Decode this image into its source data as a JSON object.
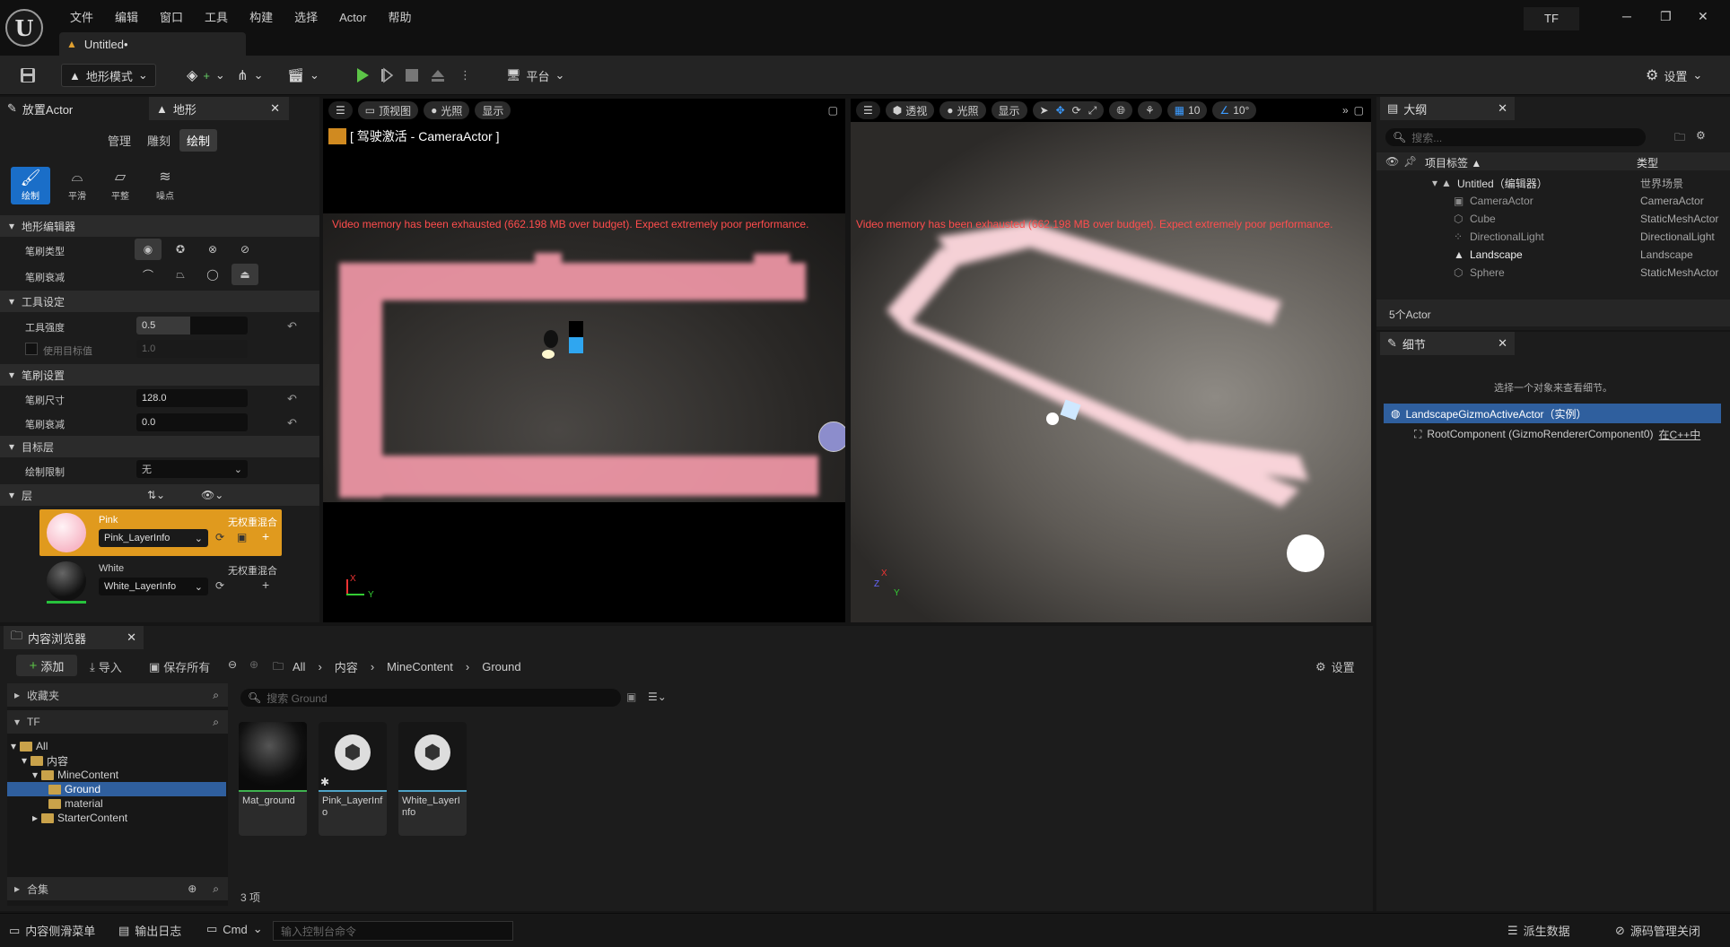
{
  "app": {
    "menu": [
      "文件",
      "编辑",
      "窗口",
      "工具",
      "构建",
      "选择",
      "Actor",
      "帮助"
    ],
    "doc_tab": "Untitled•",
    "user_badge": "TF",
    "win_min": "─",
    "win_max": "❐",
    "win_close": "✕"
  },
  "toolbar": {
    "mode": "地形模式",
    "platform": "平台",
    "settings": "设置"
  },
  "left_panel": {
    "tab_place": "放置Actor",
    "tab_landscape": "地形",
    "subtabs": [
      "管理",
      "雕刻",
      "绘制"
    ],
    "tools": [
      "绘制",
      "平滑",
      "平整",
      "噪点"
    ],
    "sec_editor": "地形编辑器",
    "brush_type": "笔刷类型",
    "brush_falloff": "笔刷衰减",
    "sec_tool": "工具设定",
    "tool_strength": "工具强度",
    "tool_strength_val": "0.5",
    "use_target": "使用目标值",
    "use_target_val": "1.0",
    "sec_brush": "笔刷设置",
    "brush_size": "笔刷尺寸",
    "brush_size_val": "128.0",
    "brush_fall_lbl": "笔刷衰减",
    "brush_fall_val": "0.0",
    "sec_target": "目标层",
    "paint_limit": "绘制限制",
    "paint_limit_val": "无",
    "sec_layers": "层",
    "layers": [
      {
        "name": "Pink",
        "info": "Pink_LayerInfo",
        "blend": "无权重混合"
      },
      {
        "name": "White",
        "info": "White_LayerInfo",
        "blend": "无权重混合"
      }
    ]
  },
  "viewport_left": {
    "view": "顶视图",
    "lighting": "光照",
    "show": "显示",
    "pilot": "[ 驾驶激活 - CameraActor ]",
    "warning": "Video memory has been exhausted (662.198 MB over budget). Expect extremely poor performance.",
    "axis_x": "X",
    "axis_y": "Y"
  },
  "viewport_right": {
    "view": "透视",
    "lighting": "光照",
    "show": "显示",
    "grid_val": "10",
    "angle_val": "10°",
    "warning": "Video memory has been exhausted (662.198 MB over budget). Expect extremely poor performance.",
    "axis_x": "X",
    "axis_z": "Z",
    "axis_y": "Y"
  },
  "outliner": {
    "title": "大纲",
    "search_placeholder": "搜索...",
    "col_label": "项目标签 ▲",
    "col_type": "类型",
    "rows": [
      {
        "name": "Untitled（编辑器）",
        "type": "世界场景"
      },
      {
        "name": "CameraActor",
        "type": "CameraActor"
      },
      {
        "name": "Cube",
        "type": "StaticMeshActor"
      },
      {
        "name": "DirectionalLight",
        "type": "DirectionalLight"
      },
      {
        "name": "Landscape",
        "type": "Landscape"
      },
      {
        "name": "Sphere",
        "type": "StaticMeshActor"
      }
    ],
    "count": "5个Actor"
  },
  "details": {
    "title": "细节",
    "hint": "选择一个对象来查看细节。",
    "actor": "LandscapeGizmoActiveActor（实例）",
    "component": "RootComponent (GizmoRendererComponent0)",
    "cpp_link": "在C++中"
  },
  "content_browser": {
    "title": "内容浏览器",
    "add": "添加",
    "import": "导入",
    "save_all": "保存所有",
    "crumbs": [
      "All",
      "内容",
      "MineContent",
      "Ground"
    ],
    "settings": "设置",
    "favorites": "收藏夹",
    "root": "TF",
    "tree": [
      "All",
      "内容",
      "MineContent",
      "Ground",
      "material",
      "StarterContent"
    ],
    "collections": "合集",
    "search_placeholder": "搜索 Ground",
    "assets": [
      "Mat_ground",
      "Pink_LayerInfo",
      "White_LayerInfo"
    ],
    "count": "3 项"
  },
  "statusbar": {
    "drawer": "内容侧滑菜单",
    "output": "输出日志",
    "cmd": "Cmd",
    "cmd_placeholder": "输入控制台命令",
    "derived": "派生数据",
    "source": "源码管理关闭"
  }
}
